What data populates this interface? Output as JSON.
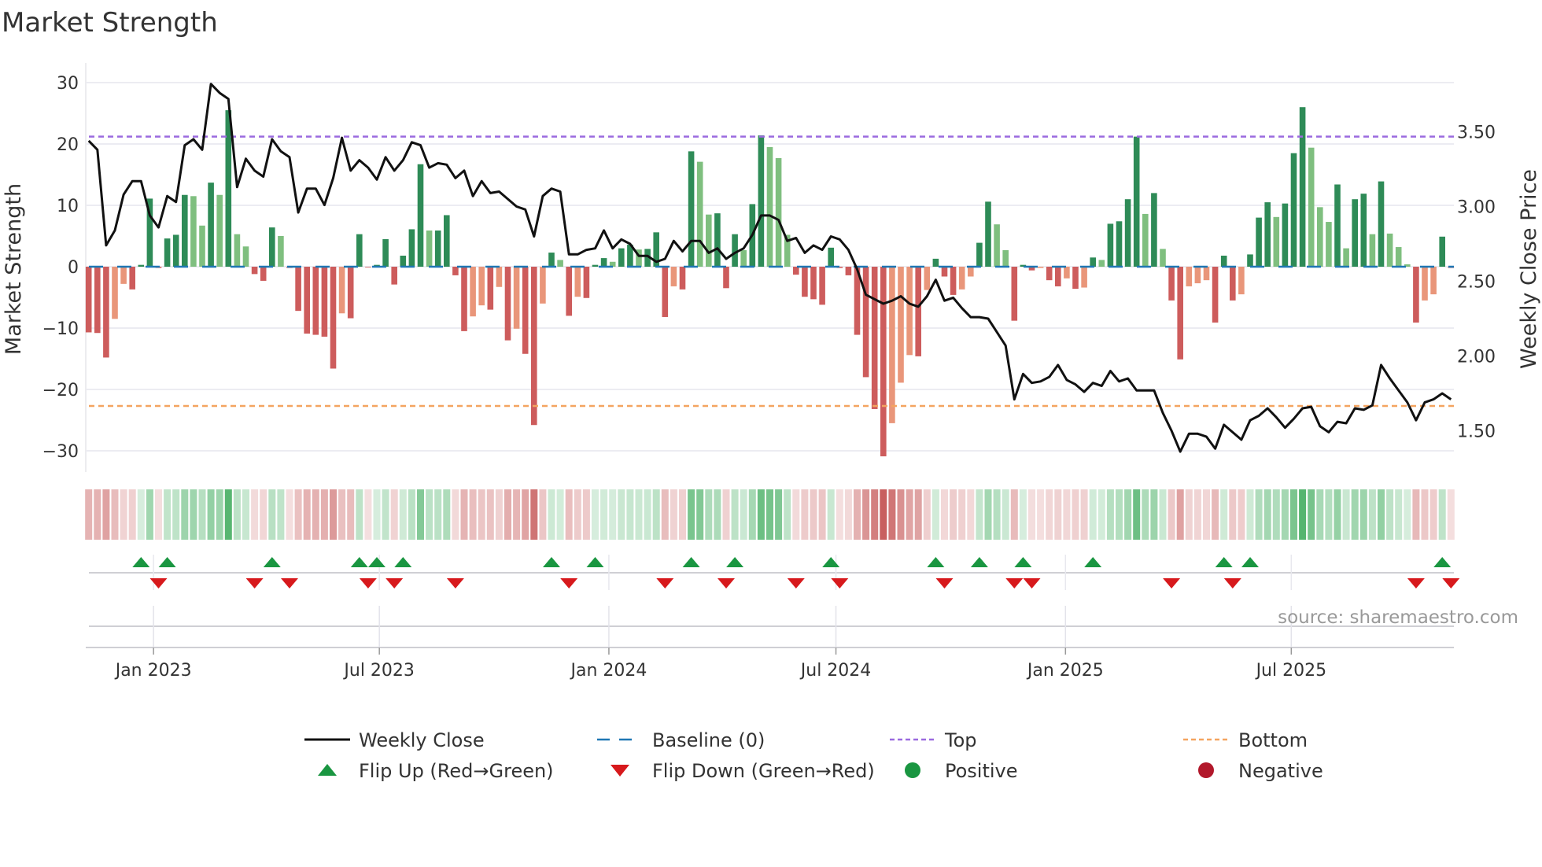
{
  "title": "Market Strength",
  "chart_data": {
    "type": "bar",
    "title": "Market Strength",
    "ylabel": "Market Strength",
    "y2label": "Weekly Close Price",
    "ylim": [
      -31,
      31
    ],
    "y2lim": [
      1.3,
      3.9
    ],
    "yticks": [
      "30",
      "20",
      "10",
      "0",
      "−10",
      "−20",
      "−30"
    ],
    "ytick_values": [
      30,
      20,
      10,
      0,
      -10,
      -20,
      -30
    ],
    "y2ticks": [
      "3.50",
      "3.00",
      "2.50",
      "2.00",
      "1.50"
    ],
    "y2tick_values": [
      3.5,
      3.0,
      2.5,
      2.0,
      1.5
    ],
    "first_week": "2022-11-10",
    "xticks": [
      {
        "label": "Jan 2023",
        "date": "2023-01-01"
      },
      {
        "label": "Jul 2023",
        "date": "2023-07-01"
      },
      {
        "label": "Jan 2024",
        "date": "2024-01-01"
      },
      {
        "label": "Jul 2024",
        "date": "2024-07-01"
      },
      {
        "label": "Jan 2025",
        "date": "2025-01-01"
      },
      {
        "label": "Jul 2025",
        "date": "2025-07-01"
      }
    ],
    "top_level": 21.2,
    "bottom_level": -22.7,
    "baseline": 0,
    "strength": [
      -10.7,
      -10.8,
      -14.8,
      -8.5,
      -2.8,
      -3.7,
      0.3,
      11.1,
      -0.2,
      4.6,
      5.2,
      11.7,
      11.5,
      6.7,
      13.7,
      11.7,
      25.5,
      5.3,
      3.3,
      -1.2,
      -2.3,
      6.4,
      5.0,
      -0.2,
      -7.2,
      -10.9,
      -11.1,
      -11.4,
      -16.6,
      -7.6,
      -8.4,
      5.3,
      -0.1,
      0.3,
      4.5,
      -2.9,
      1.8,
      6.1,
      16.7,
      5.9,
      5.9,
      8.4,
      -1.4,
      -10.5,
      -8.1,
      -6.3,
      -7.0,
      -3.3,
      -12.0,
      -10.1,
      -14.2,
      -25.8,
      -6.0,
      2.3,
      1.1,
      -8.0,
      -4.9,
      -5.1,
      0.3,
      1.4,
      0.8,
      3.0,
      3.6,
      2.8,
      2.9,
      5.6,
      -8.2,
      -3.2,
      -3.7,
      18.8,
      17.1,
      8.5,
      8.7,
      -3.5,
      5.3,
      2.7,
      10.2,
      21.4,
      19.5,
      17.7,
      5.2,
      -1.3,
      -4.9,
      -5.3,
      -6.2,
      3.1,
      -0.2,
      -1.4,
      -11.1,
      -18.0,
      -23.2,
      -30.9,
      -25.5,
      -18.9,
      -14.4,
      -14.6,
      -3.8,
      1.3,
      -1.6,
      -4.6,
      -3.7,
      -1.6,
      3.9,
      10.6,
      6.9,
      2.7,
      -8.8,
      0.3,
      -0.6,
      -0.2,
      -2.2,
      -3.2,
      -1.9,
      -3.6,
      -3.4,
      1.5,
      1.1,
      7.0,
      7.4,
      11.0,
      21.2,
      8.6,
      12.0,
      2.9,
      -5.5,
      -15.1,
      -3.2,
      -2.7,
      -2.2,
      -9.1,
      1.8,
      -5.5,
      -4.5,
      2.0,
      8.0,
      10.5,
      8.1,
      10.3,
      18.5,
      26.0,
      19.4,
      9.7,
      7.3,
      13.4,
      3.0,
      11.0,
      11.9,
      5.3,
      13.9,
      5.4,
      3.2,
      0.4,
      -9.1,
      -5.5,
      -4.5,
      4.9,
      -0.2
    ],
    "weekly_close": [
      3.44,
      3.38,
      2.74,
      2.84,
      3.08,
      3.17,
      3.17,
      2.94,
      2.86,
      3.07,
      3.03,
      3.41,
      3.45,
      3.38,
      3.82,
      3.76,
      3.72,
      3.13,
      3.32,
      3.24,
      3.2,
      3.45,
      3.37,
      3.33,
      2.96,
      3.12,
      3.12,
      3.01,
      3.19,
      3.46,
      3.24,
      3.31,
      3.26,
      3.18,
      3.33,
      3.24,
      3.31,
      3.43,
      3.41,
      3.26,
      3.29,
      3.28,
      3.19,
      3.24,
      3.07,
      3.17,
      3.09,
      3.1,
      3.05,
      3.0,
      2.98,
      2.8,
      3.07,
      3.12,
      3.1,
      2.68,
      2.68,
      2.71,
      2.72,
      2.84,
      2.72,
      2.78,
      2.75,
      2.67,
      2.67,
      2.63,
      2.65,
      2.77,
      2.7,
      2.77,
      2.77,
      2.69,
      2.72,
      2.65,
      2.69,
      2.72,
      2.81,
      2.94,
      2.94,
      2.91,
      2.77,
      2.79,
      2.69,
      2.74,
      2.71,
      2.8,
      2.78,
      2.71,
      2.58,
      2.41,
      2.38,
      2.35,
      2.37,
      2.4,
      2.35,
      2.33,
      2.4,
      2.51,
      2.37,
      2.39,
      2.32,
      2.26,
      2.26,
      2.25,
      2.16,
      2.07,
      1.71,
      1.88,
      1.82,
      1.83,
      1.86,
      1.94,
      1.84,
      1.81,
      1.76,
      1.82,
      1.8,
      1.9,
      1.83,
      1.85,
      1.77,
      1.77,
      1.77,
      1.62,
      1.5,
      1.36,
      1.48,
      1.48,
      1.46,
      1.38,
      1.54,
      1.49,
      1.44,
      1.57,
      1.6,
      1.65,
      1.59,
      1.52,
      1.58,
      1.65,
      1.66,
      1.53,
      1.49,
      1.56,
      1.55,
      1.65,
      1.64,
      1.67,
      1.94,
      1.85,
      1.77,
      1.69,
      1.57,
      1.69,
      1.71,
      1.75,
      1.71
    ],
    "legend": {
      "placement": "bottom",
      "entries": [
        {
          "key": "close",
          "label": "Weekly Close"
        },
        {
          "key": "baseline",
          "label": "Baseline (0)"
        },
        {
          "key": "top",
          "label": "Top"
        },
        {
          "key": "bottom",
          "label": "Bottom"
        },
        {
          "key": "flip_up",
          "label": "Flip Up (Red→Green)"
        },
        {
          "key": "flip_down",
          "label": "Flip Down (Green→Red)"
        },
        {
          "key": "positive",
          "label": "Positive"
        },
        {
          "key": "negative",
          "label": "Negative"
        }
      ]
    }
  },
  "source": "source: sharemaestro.com",
  "colors": {
    "strong_green": "#2e8b57",
    "weak_green": "#7fbf7f",
    "strong_red": "#cd5c5c",
    "weak_red": "#e9967a",
    "top": "#9b6bdf",
    "bottom": "#f4a460",
    "baseline": "#1f77b4",
    "flip_up": "#1a9641",
    "flip_down": "#d7191c",
    "positive": "#1a9641",
    "negative": "#b2182b",
    "close": "#111111"
  }
}
